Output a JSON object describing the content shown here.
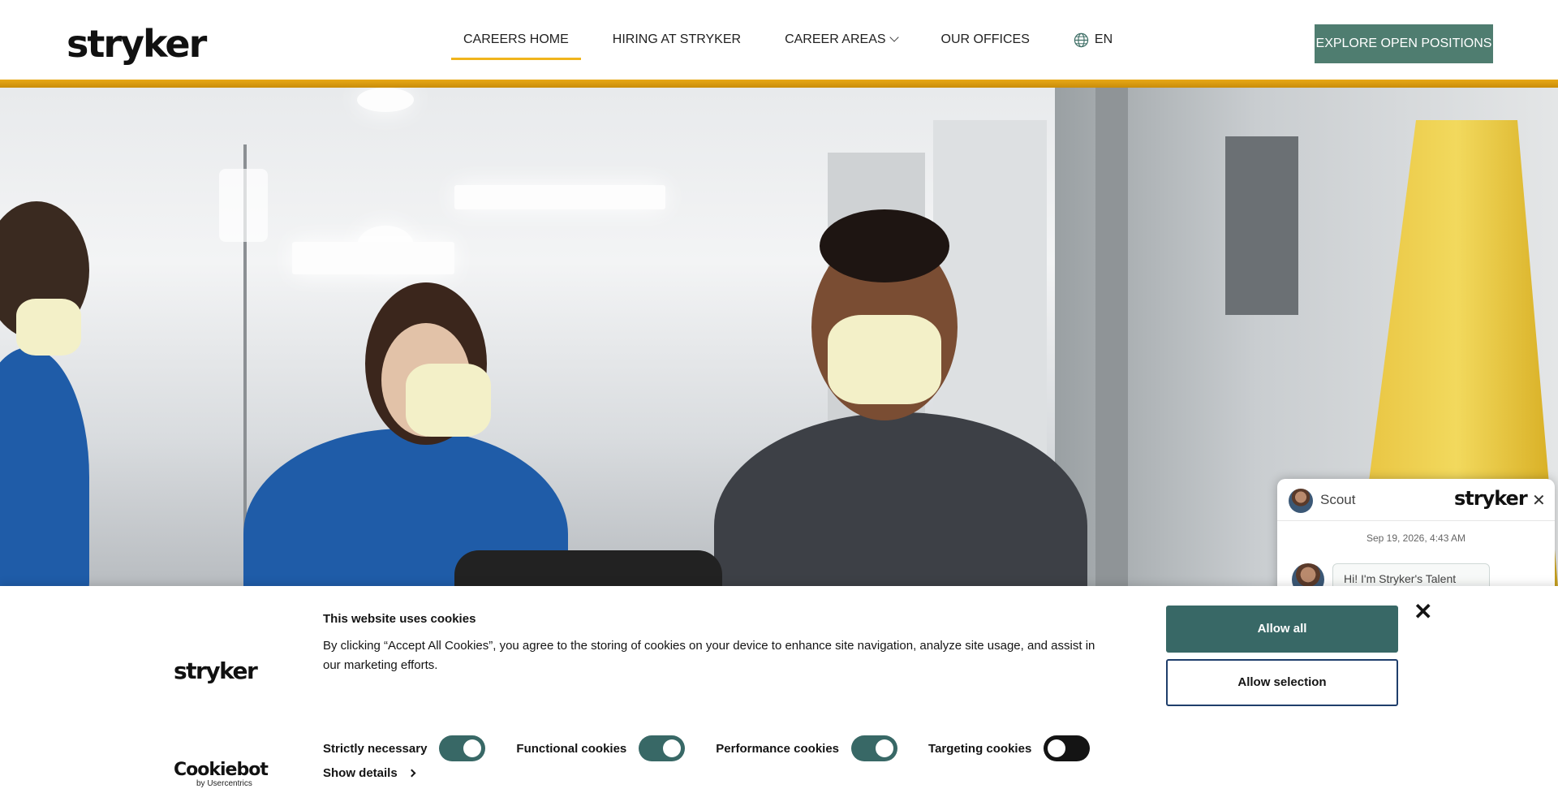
{
  "header": {
    "logo": "stryker",
    "nav": [
      {
        "label": "CAREERS HOME",
        "active": true
      },
      {
        "label": "HIRING AT STRYKER"
      },
      {
        "label": "CAREER AREAS",
        "has_dropdown": true
      },
      {
        "label": "OUR OFFICES"
      }
    ],
    "language": "EN",
    "cta": "EXPLORE OPEN POSITIONS"
  },
  "colors": {
    "accent_bar": "#e8a817",
    "cta_bg": "#4f7d70",
    "cookie_primary": "#386866",
    "selection_border": "#1f3e6b"
  },
  "chat": {
    "bot_name": "Scout",
    "logo": "stryker",
    "timestamp": "Sep 19, 2026, 4:43 AM",
    "message": "Hi! I'm Stryker's Talent"
  },
  "cookie": {
    "logo": "stryker",
    "title": "This website uses cookies",
    "text": "By clicking “Accept All Cookies”, you agree to the storing of cookies on your device to enhance site navigation, analyze site usage, and assist in our marketing efforts.",
    "toggles": [
      {
        "label": "Strictly necessary",
        "on": true
      },
      {
        "label": "Functional cookies",
        "on": true
      },
      {
        "label": "Performance cookies",
        "on": true
      },
      {
        "label": "Targeting cookies",
        "on": false
      }
    ],
    "show_details": "Show details",
    "allow_all": "Allow all",
    "allow_selection": "Allow selection",
    "cookiebot_brand": "Cookiebot",
    "cookiebot_sub": "by Usercentrics"
  }
}
